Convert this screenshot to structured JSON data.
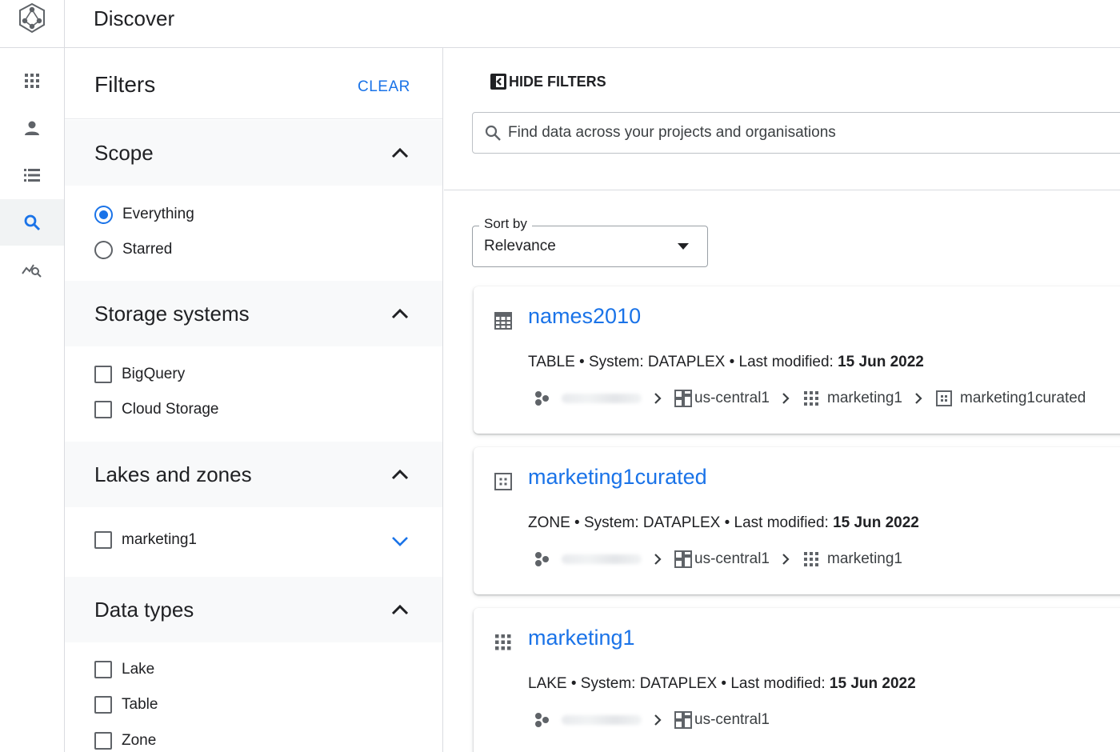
{
  "header": {
    "title": "Discover",
    "logo_icon": "dataplex-logo-icon"
  },
  "rail": {
    "items": [
      {
        "icon": "apps-grid-icon",
        "active": false
      },
      {
        "icon": "person-icon",
        "active": false
      },
      {
        "icon": "list-icon",
        "active": false
      },
      {
        "icon": "search-icon",
        "active": true
      },
      {
        "icon": "query-insights-icon",
        "active": false
      }
    ]
  },
  "filters": {
    "title": "Filters",
    "clear_label": "CLEAR",
    "scope": {
      "title": "Scope",
      "options": [
        {
          "label": "Everything",
          "selected": true
        },
        {
          "label": "Starred",
          "selected": false
        }
      ]
    },
    "storage": {
      "title": "Storage systems",
      "options": [
        {
          "label": "BigQuery",
          "checked": false
        },
        {
          "label": "Cloud Storage",
          "checked": false
        }
      ]
    },
    "lakes": {
      "title": "Lakes and zones",
      "options": [
        {
          "label": "marketing1",
          "checked": false
        }
      ]
    },
    "data_types": {
      "title": "Data types",
      "options": [
        {
          "label": "Lake",
          "checked": false
        },
        {
          "label": "Table",
          "checked": false
        },
        {
          "label": "Zone",
          "checked": false
        }
      ]
    }
  },
  "main": {
    "hide_filters_label": "HIDE FILTERS",
    "search_placeholder": "Find data across your projects and organisations",
    "sort": {
      "label": "Sort by",
      "value": "Relevance"
    },
    "results": [
      {
        "title": "names2010",
        "icon": "table-icon",
        "type": "TABLE",
        "system_text": " • System: DATAPLEX • Last modified: ",
        "date": "15 Jun 2022",
        "crumbs": [
          "us-central1",
          "marketing1",
          "marketing1curated"
        ]
      },
      {
        "title": "marketing1curated",
        "icon": "zone-icon",
        "type": "ZONE",
        "system_text": " • System: DATAPLEX • Last modified: ",
        "date": "15 Jun 2022",
        "crumbs": [
          "us-central1",
          "marketing1"
        ]
      },
      {
        "title": "marketing1",
        "icon": "lake-icon",
        "type": "LAKE",
        "system_text": " • System: DATAPLEX • Last modified: ",
        "date": "15 Jun 2022",
        "crumbs": [
          "us-central1"
        ]
      }
    ]
  },
  "colors": {
    "accent": "#1a73e8",
    "text": "#202124",
    "border": "#dadce0",
    "section_bg": "#f8f9fa"
  }
}
